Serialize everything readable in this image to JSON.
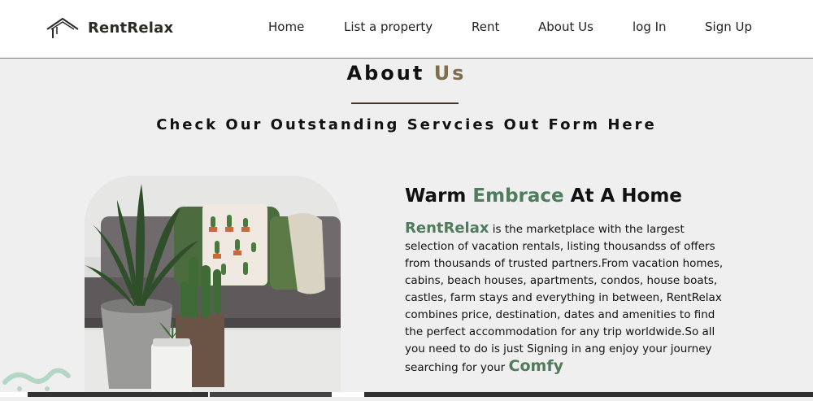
{
  "brand": {
    "name": "RentRelax",
    "icon": "house-roof-icon"
  },
  "nav": {
    "items": [
      "Home",
      "List a property",
      "Rent",
      "About Us",
      "log In",
      "Sign Up"
    ]
  },
  "about": {
    "title_part1": "About",
    "title_part2": "Us",
    "subtitle": "Check Our Outstanding Servcies Out Form Here"
  },
  "feature": {
    "heading_part1": "Warm",
    "heading_part2": "Embrace",
    "heading_part3": "At A Home",
    "brand_word": "RentRelax",
    "body": "is the marketplace with the largest selection of vacation rentals, listing thousandss of offers from thousands of trusted partners.From vacation homes, cabins, beach houses, apartments, condos, house boats, castles, farm stays and everything in between, RentRelax combines price, destination, dates and amenities to find the perfect accommodation for any trip worldwide.So all you need to do is just Signing in ang enjoy your journey searching for your",
    "closing_word": "Comfy"
  },
  "colors": {
    "accent_gold": "#7e6f4e",
    "accent_green": "#4f7c5c",
    "underline": "#4a3322",
    "background": "#efefef"
  }
}
